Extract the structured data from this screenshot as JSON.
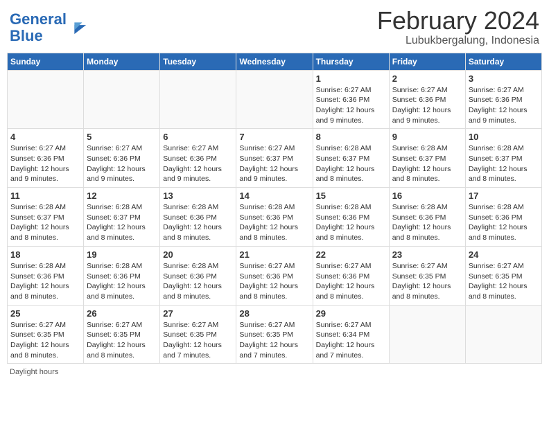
{
  "header": {
    "logo_line1": "General",
    "logo_line2": "Blue",
    "month_title": "February 2024",
    "subtitle": "Lubukbergalung, Indonesia"
  },
  "days_of_week": [
    "Sunday",
    "Monday",
    "Tuesday",
    "Wednesday",
    "Thursday",
    "Friday",
    "Saturday"
  ],
  "footer": {
    "note": "Daylight hours"
  },
  "weeks": [
    [
      {
        "day": "",
        "info": ""
      },
      {
        "day": "",
        "info": ""
      },
      {
        "day": "",
        "info": ""
      },
      {
        "day": "",
        "info": ""
      },
      {
        "day": "1",
        "info": "Sunrise: 6:27 AM\nSunset: 6:36 PM\nDaylight: 12 hours\nand 9 minutes."
      },
      {
        "day": "2",
        "info": "Sunrise: 6:27 AM\nSunset: 6:36 PM\nDaylight: 12 hours\nand 9 minutes."
      },
      {
        "day": "3",
        "info": "Sunrise: 6:27 AM\nSunset: 6:36 PM\nDaylight: 12 hours\nand 9 minutes."
      }
    ],
    [
      {
        "day": "4",
        "info": "Sunrise: 6:27 AM\nSunset: 6:36 PM\nDaylight: 12 hours\nand 9 minutes."
      },
      {
        "day": "5",
        "info": "Sunrise: 6:27 AM\nSunset: 6:36 PM\nDaylight: 12 hours\nand 9 minutes."
      },
      {
        "day": "6",
        "info": "Sunrise: 6:27 AM\nSunset: 6:36 PM\nDaylight: 12 hours\nand 9 minutes."
      },
      {
        "day": "7",
        "info": "Sunrise: 6:27 AM\nSunset: 6:37 PM\nDaylight: 12 hours\nand 9 minutes."
      },
      {
        "day": "8",
        "info": "Sunrise: 6:28 AM\nSunset: 6:37 PM\nDaylight: 12 hours\nand 8 minutes."
      },
      {
        "day": "9",
        "info": "Sunrise: 6:28 AM\nSunset: 6:37 PM\nDaylight: 12 hours\nand 8 minutes."
      },
      {
        "day": "10",
        "info": "Sunrise: 6:28 AM\nSunset: 6:37 PM\nDaylight: 12 hours\nand 8 minutes."
      }
    ],
    [
      {
        "day": "11",
        "info": "Sunrise: 6:28 AM\nSunset: 6:37 PM\nDaylight: 12 hours\nand 8 minutes."
      },
      {
        "day": "12",
        "info": "Sunrise: 6:28 AM\nSunset: 6:37 PM\nDaylight: 12 hours\nand 8 minutes."
      },
      {
        "day": "13",
        "info": "Sunrise: 6:28 AM\nSunset: 6:36 PM\nDaylight: 12 hours\nand 8 minutes."
      },
      {
        "day": "14",
        "info": "Sunrise: 6:28 AM\nSunset: 6:36 PM\nDaylight: 12 hours\nand 8 minutes."
      },
      {
        "day": "15",
        "info": "Sunrise: 6:28 AM\nSunset: 6:36 PM\nDaylight: 12 hours\nand 8 minutes."
      },
      {
        "day": "16",
        "info": "Sunrise: 6:28 AM\nSunset: 6:36 PM\nDaylight: 12 hours\nand 8 minutes."
      },
      {
        "day": "17",
        "info": "Sunrise: 6:28 AM\nSunset: 6:36 PM\nDaylight: 12 hours\nand 8 minutes."
      }
    ],
    [
      {
        "day": "18",
        "info": "Sunrise: 6:28 AM\nSunset: 6:36 PM\nDaylight: 12 hours\nand 8 minutes."
      },
      {
        "day": "19",
        "info": "Sunrise: 6:28 AM\nSunset: 6:36 PM\nDaylight: 12 hours\nand 8 minutes."
      },
      {
        "day": "20",
        "info": "Sunrise: 6:28 AM\nSunset: 6:36 PM\nDaylight: 12 hours\nand 8 minutes."
      },
      {
        "day": "21",
        "info": "Sunrise: 6:27 AM\nSunset: 6:36 PM\nDaylight: 12 hours\nand 8 minutes."
      },
      {
        "day": "22",
        "info": "Sunrise: 6:27 AM\nSunset: 6:36 PM\nDaylight: 12 hours\nand 8 minutes."
      },
      {
        "day": "23",
        "info": "Sunrise: 6:27 AM\nSunset: 6:35 PM\nDaylight: 12 hours\nand 8 minutes."
      },
      {
        "day": "24",
        "info": "Sunrise: 6:27 AM\nSunset: 6:35 PM\nDaylight: 12 hours\nand 8 minutes."
      }
    ],
    [
      {
        "day": "25",
        "info": "Sunrise: 6:27 AM\nSunset: 6:35 PM\nDaylight: 12 hours\nand 8 minutes."
      },
      {
        "day": "26",
        "info": "Sunrise: 6:27 AM\nSunset: 6:35 PM\nDaylight: 12 hours\nand 8 minutes."
      },
      {
        "day": "27",
        "info": "Sunrise: 6:27 AM\nSunset: 6:35 PM\nDaylight: 12 hours\nand 7 minutes."
      },
      {
        "day": "28",
        "info": "Sunrise: 6:27 AM\nSunset: 6:35 PM\nDaylight: 12 hours\nand 7 minutes."
      },
      {
        "day": "29",
        "info": "Sunrise: 6:27 AM\nSunset: 6:34 PM\nDaylight: 12 hours\nand 7 minutes."
      },
      {
        "day": "",
        "info": ""
      },
      {
        "day": "",
        "info": ""
      }
    ]
  ]
}
